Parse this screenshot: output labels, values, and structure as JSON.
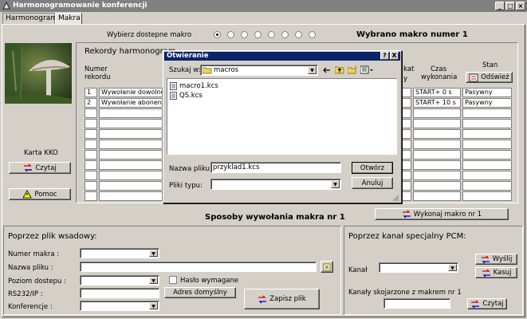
{
  "window": {
    "title": "Harmonogramowanie konferencji"
  },
  "tabs": [
    {
      "label": "Harmonogram"
    },
    {
      "label": "Makra"
    }
  ],
  "macro_select": {
    "label": "Wybierz dostepne makro",
    "selected_text": "Wybrano makro numer 1",
    "selected_index": 0,
    "count": 8
  },
  "left": {
    "card_label": "Karta KKO",
    "read_button": "Czytaj",
    "help_button": "Pomoc"
  },
  "records": {
    "title": "Rekordy harmonogram",
    "col_number": "Numer rekordu",
    "col_kat": "kat",
    "col_kat2": "y",
    "col_time": "Czas wykonania",
    "col_state": "Stan",
    "refresh_button": "Odśwież",
    "rows": [
      {
        "num": "1",
        "name": "Wywołanie dowolnej",
        "time": "START+ 0 s",
        "state": "Pasywny"
      },
      {
        "num": "2",
        "name": "Wywołanie abonenta",
        "time": "START+ 10 s",
        "state": "Pasywny"
      }
    ]
  },
  "dialog": {
    "title": "Otwieranie",
    "help": "?",
    "close": "X",
    "lookin_label": "Szukaj w:",
    "lookin_value": "macros",
    "files": [
      "macro1.kcs",
      "QS.kcs"
    ],
    "filename_label": "Nazwa pliku:",
    "filename_value": "przyklad1.kcs",
    "filetype_label": "Pliki typu:",
    "filetype_value": "",
    "open_button": "Otwórz",
    "cancel_button": "Anuluj"
  },
  "execute_button": "Wykonaj makro nr 1",
  "methods_title": "Sposoby wywołania makra nr 1",
  "batch": {
    "title": "Poprzez plik wsadowy:",
    "macro_number_label": "Numer makra :",
    "file_name_label": "Nazwa pliku :",
    "access_level_label": "Poziom dostepu :",
    "password_label": "Hasło wymagane",
    "rs232_label": "RS232/IP :",
    "default_address_button": "Adres domyślny",
    "conference_label": "Konferencje :",
    "save_button": "Zapisz plik"
  },
  "pcm": {
    "title": "Poprzez kanał specjalny PCM:",
    "send_button": "Wyślij",
    "delete_button": "Kasuj",
    "channel_label": "Kanał",
    "linked_label": "Kanały skojarzone z makrem nr 1",
    "read_button": "Czytaj"
  }
}
